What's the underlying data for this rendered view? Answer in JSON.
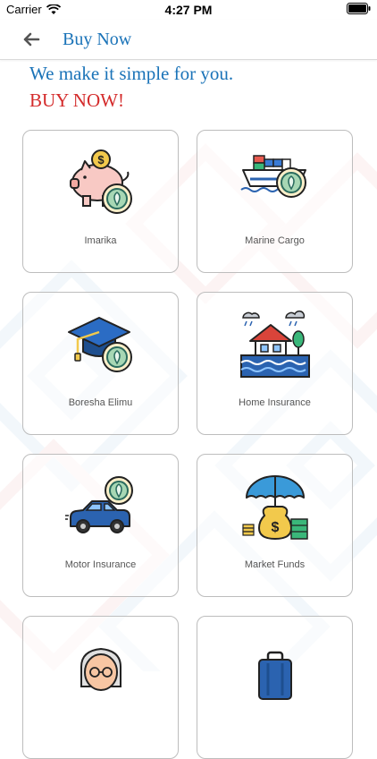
{
  "status_bar": {
    "carrier": "Carrier",
    "time": "4:27 PM"
  },
  "nav": {
    "title": "Buy Now",
    "back_icon": "arrow-left-icon"
  },
  "intro": {
    "line1": "We make it simple for you.",
    "line2": "BUY NOW!"
  },
  "colors": {
    "accent_blue": "#1a73b8",
    "accent_red": "#d42b2b",
    "shield_green": "#a7d7b4",
    "shield_ring": "#2a6b5e"
  },
  "products": [
    {
      "label": "Imarika",
      "icon": "piggy-bank-shield-icon"
    },
    {
      "label": "Marine Cargo",
      "icon": "cargo-ship-shield-icon"
    },
    {
      "label": "Boresha Elimu",
      "icon": "graduation-cap-shield-icon"
    },
    {
      "label": "Home Insurance",
      "icon": "flooded-house-icon"
    },
    {
      "label": "Motor Insurance",
      "icon": "car-shield-icon"
    },
    {
      "label": "Market Funds",
      "icon": "umbrella-money-icon"
    },
    {
      "label": "",
      "icon": "elderly-person-icon"
    },
    {
      "label": "",
      "icon": "luggage-icon"
    }
  ]
}
